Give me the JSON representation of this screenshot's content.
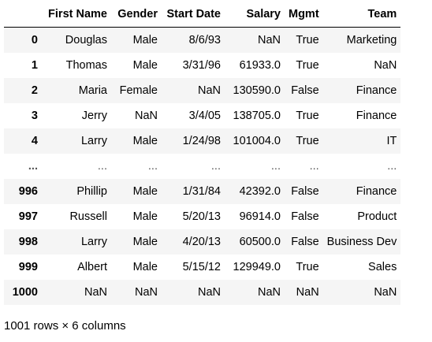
{
  "table": {
    "columns": [
      "",
      "First Name",
      "Gender",
      "Start Date",
      "Salary",
      "Mgmt",
      "Team"
    ],
    "rows": [
      [
        "0",
        "Douglas",
        "Male",
        "8/6/93",
        "NaN",
        "True",
        "Marketing"
      ],
      [
        "1",
        "Thomas",
        "Male",
        "3/31/96",
        "61933.0",
        "True",
        "NaN"
      ],
      [
        "2",
        "Maria",
        "Female",
        "NaN",
        "130590.0",
        "False",
        "Finance"
      ],
      [
        "3",
        "Jerry",
        "NaN",
        "3/4/05",
        "138705.0",
        "True",
        "Finance"
      ],
      [
        "4",
        "Larry",
        "Male",
        "1/24/98",
        "101004.0",
        "True",
        "IT"
      ],
      [
        "...",
        "...",
        "...",
        "...",
        "...",
        "...",
        "..."
      ],
      [
        "996",
        "Phillip",
        "Male",
        "1/31/84",
        "42392.0",
        "False",
        "Finance"
      ],
      [
        "997",
        "Russell",
        "Male",
        "5/20/13",
        "96914.0",
        "False",
        "Product"
      ],
      [
        "998",
        "Larry",
        "Male",
        "4/20/13",
        "60500.0",
        "False",
        "Business Dev"
      ],
      [
        "999",
        "Albert",
        "Male",
        "5/15/12",
        "129949.0",
        "True",
        "Sales"
      ],
      [
        "1000",
        "NaN",
        "NaN",
        "NaN",
        "NaN",
        "NaN",
        "NaN"
      ]
    ]
  },
  "footer": {
    "shape_text": "1001 rows × 6 columns"
  }
}
